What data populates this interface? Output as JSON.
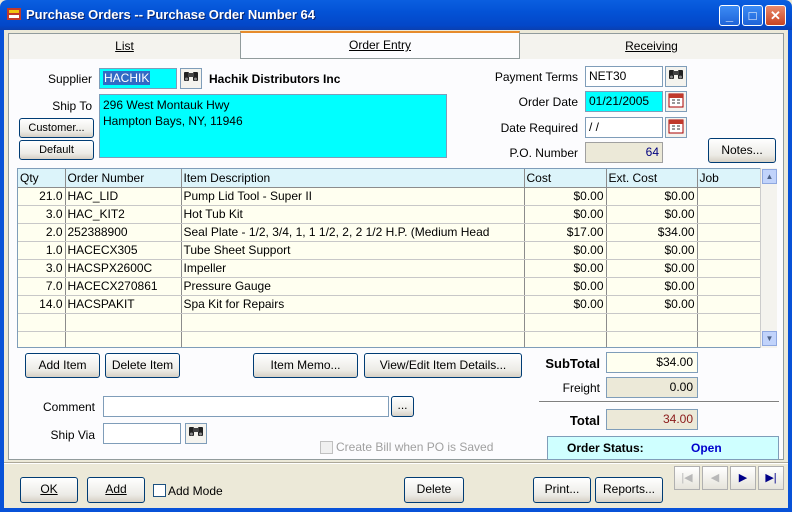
{
  "window": {
    "title": "Purchase Orders -- Purchase Order Number 64",
    "minimize": "_",
    "maximize": "□",
    "close": "✕"
  },
  "tabs": [
    {
      "label": "List"
    },
    {
      "label": "Order Entry",
      "active": true
    },
    {
      "label": "Receiving"
    }
  ],
  "header": {
    "supplier_label": "Supplier",
    "supplier_code": "HACHIK",
    "supplier_name": "Hachik Distributors Inc",
    "ship_to_label": "Ship To",
    "ship_to_line1": "296 West Montauk Hwy",
    "ship_to_line2": "Hampton Bays, NY, 11946",
    "customer_button": "Customer...",
    "default_button": "Default",
    "payment_terms_label": "Payment Terms",
    "payment_terms": "NET30",
    "order_date_label": "Order Date",
    "order_date": "01/21/2005",
    "date_required_label": "Date Required",
    "date_required": " / /",
    "po_number_label": "P.O. Number",
    "po_number": "64",
    "notes_button": "Notes..."
  },
  "grid": {
    "columns": [
      "Qty",
      "Order Number",
      "Item Description",
      "Cost",
      "Ext. Cost",
      "Job"
    ],
    "rows": [
      [
        "21.0",
        "HAC_LID",
        "Pump Lid Tool - Super II",
        "$0.00",
        "$0.00",
        ""
      ],
      [
        "3.0",
        "HAC_KIT2",
        "Hot Tub Kit",
        "$0.00",
        "$0.00",
        ""
      ],
      [
        "2.0",
        "252388900",
        "Seal Plate - 1/2, 3/4, 1, 1 1/2, 2, 2 1/2 H.P. (Medium Head",
        "$17.00",
        "$34.00",
        ""
      ],
      [
        "1.0",
        "HACECX305",
        "Tube Sheet Support",
        "$0.00",
        "$0.00",
        ""
      ],
      [
        "3.0",
        "HACSPX2600C",
        "Impeller",
        "$0.00",
        "$0.00",
        ""
      ],
      [
        "7.0",
        "HACECX270861",
        "Pressure Gauge",
        "$0.00",
        "$0.00",
        ""
      ],
      [
        "14.0",
        "HACSPAKIT",
        "Spa Kit for Repairs",
        "$0.00",
        "$0.00",
        ""
      ],
      [
        "",
        "",
        "",
        "",
        "",
        ""
      ],
      [
        "",
        "",
        "",
        "",
        "",
        ""
      ]
    ]
  },
  "item_buttons": {
    "add_item": "Add Item",
    "delete_item": "Delete Item",
    "item_memo": "Item Memo...",
    "view_edit": "View/Edit Item Details..."
  },
  "footer_fields": {
    "comment_label": "Comment",
    "comment_value": "",
    "ellipsis": "...",
    "ship_via_label": "Ship Via",
    "ship_via_value": "",
    "create_bill_label": "Create Bill when PO is Saved"
  },
  "totals": {
    "subtotal_label": "SubTotal",
    "subtotal": "$34.00",
    "freight_label": "Freight",
    "freight": "0.00",
    "total_label": "Total",
    "total": "34.00"
  },
  "status": {
    "label": "Order Status:",
    "value": "Open"
  },
  "bottom_bar": {
    "ok": "OK",
    "add": "Add",
    "add_mode": "Add Mode",
    "delete": "Delete",
    "print": "Print...",
    "reports": "Reports..."
  },
  "colors": {
    "total_value": "#8B1A1A",
    "status_value": "#0000CC",
    "po_number": "#000080"
  }
}
